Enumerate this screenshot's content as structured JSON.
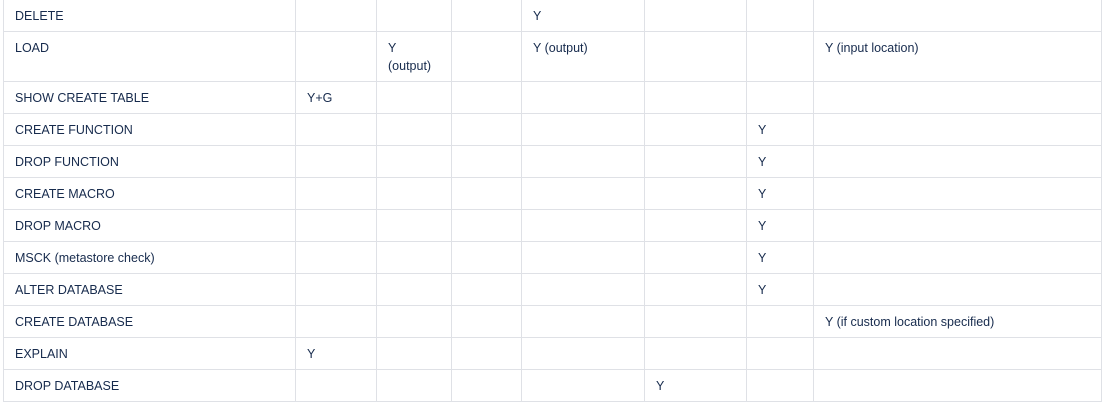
{
  "table": {
    "rows": [
      {
        "cells": [
          "DELETE",
          "",
          "",
          "",
          "Y",
          "",
          "",
          ""
        ]
      },
      {
        "cells": [
          "LOAD",
          "",
          "Y\n(output)",
          "",
          "Y (output)",
          "",
          "",
          "Y (input location)"
        ],
        "tall": true
      },
      {
        "cells": [
          "SHOW CREATE TABLE",
          "Y+G",
          "",
          "",
          "",
          "",
          "",
          ""
        ]
      },
      {
        "cells": [
          "CREATE FUNCTION",
          "",
          "",
          "",
          "",
          "",
          "Y",
          ""
        ]
      },
      {
        "cells": [
          "DROP FUNCTION",
          "",
          "",
          "",
          "",
          "",
          "Y",
          ""
        ]
      },
      {
        "cells": [
          "CREATE MACRO",
          "",
          "",
          "",
          "",
          "",
          "Y",
          ""
        ]
      },
      {
        "cells": [
          "DROP MACRO",
          "",
          "",
          "",
          "",
          "",
          "Y",
          ""
        ]
      },
      {
        "cells": [
          "MSCK (metastore check)",
          "",
          "",
          "",
          "",
          "",
          "Y",
          ""
        ]
      },
      {
        "cells": [
          "ALTER DATABASE",
          "",
          "",
          "",
          "",
          "",
          "Y",
          ""
        ]
      },
      {
        "cells": [
          "CREATE DATABASE",
          "",
          "",
          "",
          "",
          "",
          "",
          "Y (if custom location specified)"
        ]
      },
      {
        "cells": [
          "EXPLAIN",
          "Y",
          "",
          "",
          "",
          "",
          "",
          ""
        ]
      },
      {
        "cells": [
          "DROP DATABASE",
          "",
          "",
          "",
          "",
          "Y",
          "",
          ""
        ]
      }
    ]
  }
}
